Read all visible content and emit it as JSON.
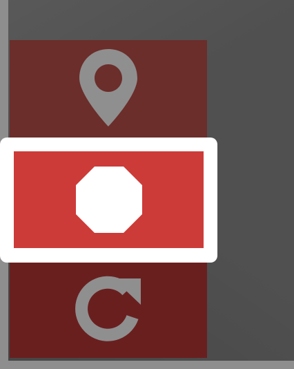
{
  "controls": {
    "locate": {
      "icon": "map-pin-icon",
      "state": "inactive"
    },
    "stop": {
      "icon": "stop-octagon-icon",
      "state": "active"
    },
    "refresh": {
      "icon": "refresh-icon",
      "state": "inactive"
    }
  },
  "colors": {
    "background": "#505050",
    "frame": "#8e8e8e",
    "panel": "#6a1f1f",
    "panel_top": "#6b2e2b",
    "stop_active": "#cc3b38",
    "highlight": "#ffffff",
    "icon_inactive": "#8f8f8f",
    "icon_active": "#ffffff"
  }
}
